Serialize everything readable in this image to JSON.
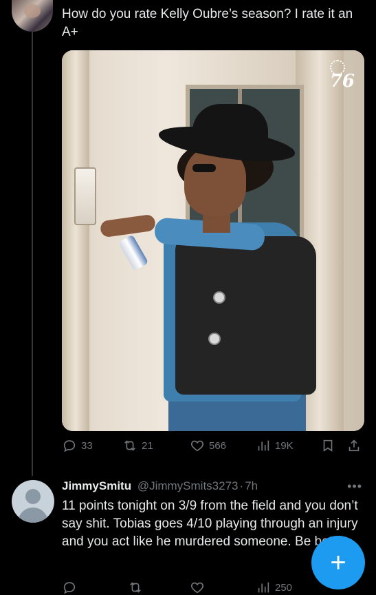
{
  "tweet": {
    "text": "How do you rate Kelly Oubre’s season? I rate it an A+",
    "media": {
      "logo_text": "76"
    },
    "actions": {
      "replies": "33",
      "retweets": "21",
      "likes": "566",
      "views": "19K"
    }
  },
  "reply": {
    "display_name": "JimmySmitu",
    "handle": "@JimmySmits3273",
    "separator": "·",
    "time": "7h",
    "more": "•••",
    "text": "11 points tonight on 3/9 from the field and you don’t say shit. Tobias goes 4/10 playing through an injury and you act like he murdered someone. Be better.",
    "actions": {
      "views": "250"
    }
  },
  "fab": {
    "label": "+"
  },
  "colors": {
    "accent": "#1d9bf0",
    "muted": "#71767b",
    "text": "#e7e9ea",
    "background": "#000000"
  },
  "icons": [
    "reply-icon",
    "retweet-icon",
    "like-icon",
    "views-icon",
    "bookmark-icon",
    "share-icon",
    "plus-icon"
  ]
}
